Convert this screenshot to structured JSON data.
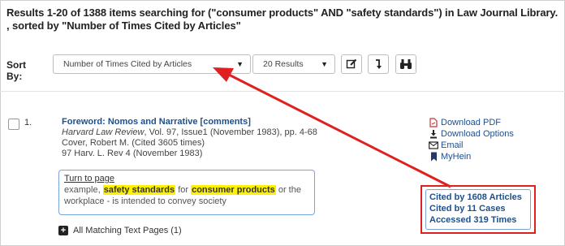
{
  "results_header": "Results 1-20 of 1388 items searching for (\"consumer products\" AND \"safety standards\") in Law Journal Library. , sorted by \"Number of Times Cited by Articles\"",
  "sort_bar": {
    "label": "Sort By:",
    "sort_selected": "Number of Times Cited by Articles",
    "results_selected": "20 Results",
    "buttons": [
      "edit-icon",
      "sort-order-icon",
      "binoculars-icon"
    ]
  },
  "result": {
    "number": "1.",
    "title": "Foreword: Nomos and Narrative [comments]",
    "journal": "Harvard Law Review",
    "journal_rest": ", Vol. 97, Issue1 (November 1983), pp. 4-68",
    "author": "Cover, Robert M. (Cited 3605 times)",
    "citation": "97 Harv. L. Rev 4 (November 1983)",
    "snippet": {
      "link": "Turn to page",
      "pre": "example, ",
      "hl1": "safety standards",
      "mid": " for ",
      "hl2": "consumer products",
      "post": " or the workplace - is intended to convey society"
    },
    "all_pages": "All Matching Text Pages (1)",
    "actions": [
      "Download PDF",
      "Download Options",
      "Email",
      "MyHein"
    ],
    "cited_by_articles": "Cited by 1608 Articles",
    "cited_by_cases": "Cited by 11 Cases",
    "accessed": "Accessed 319 Times"
  },
  "colors": {
    "accent": "#1f4f8b",
    "highlight": "#fff200",
    "annotation": "#e02020"
  }
}
